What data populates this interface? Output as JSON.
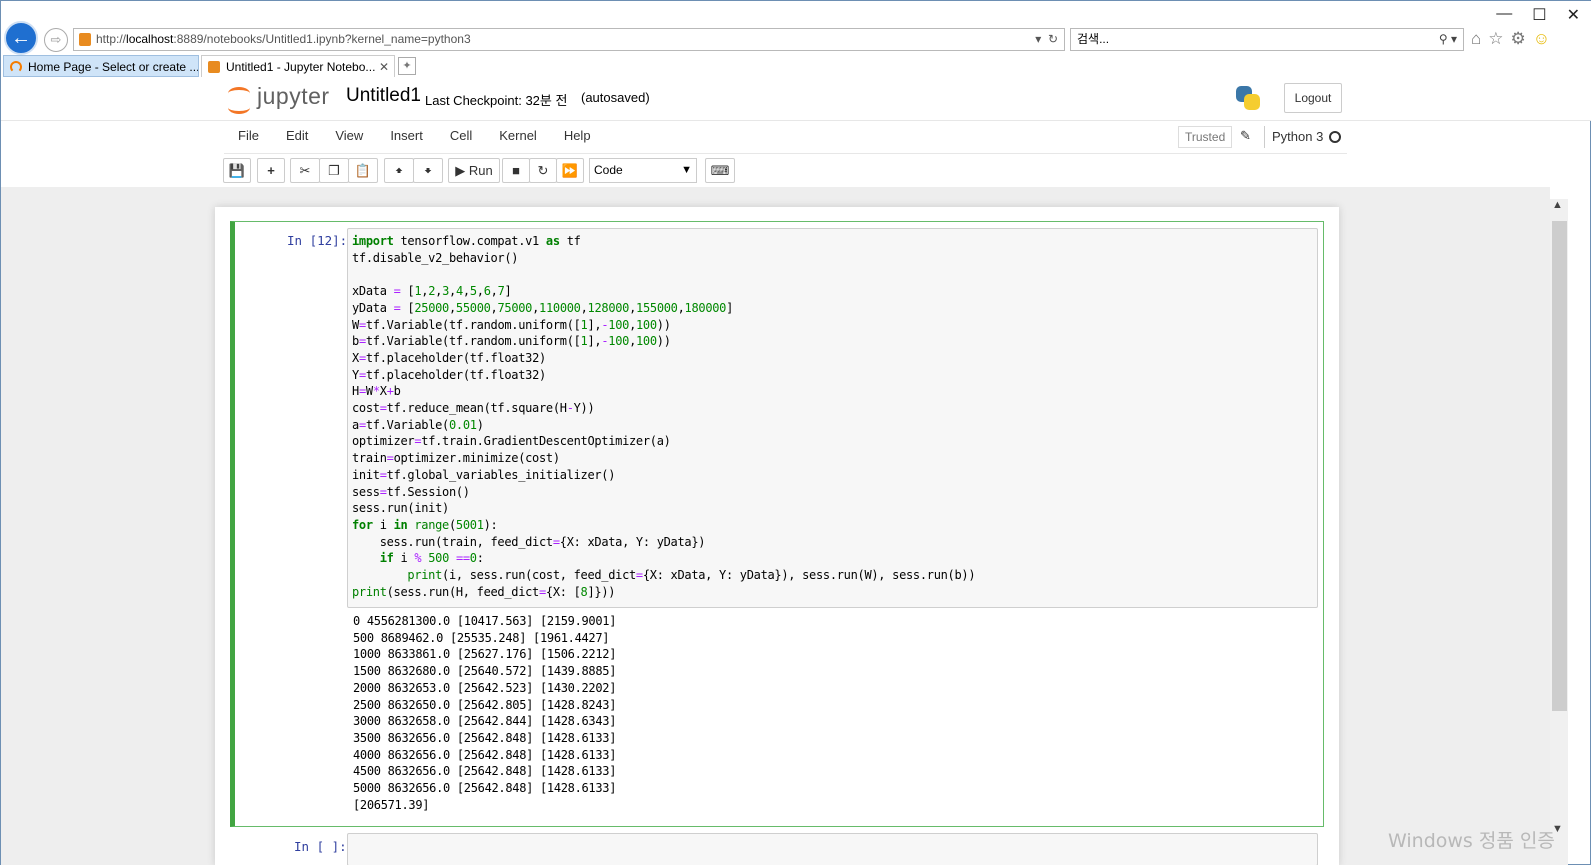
{
  "browser": {
    "url_prefix": "http://",
    "url_host": "localhost",
    "url_rest": ":8889/notebooks/Untitled1.ipynb?kernel_name=python3",
    "search_placeholder": "검색...",
    "tabs": [
      {
        "label": "Home Page - Select or create ..."
      },
      {
        "label": "Untitled1 - Jupyter Notebo..."
      }
    ]
  },
  "header": {
    "wordmark": "jupyter",
    "notebook_title": "Untitled1",
    "checkpoint": "Last Checkpoint: 32분 전",
    "autosave_status": "(autosaved)",
    "logout_label": "Logout"
  },
  "menubar": {
    "items": [
      "File",
      "Edit",
      "View",
      "Insert",
      "Cell",
      "Kernel",
      "Help"
    ],
    "trusted_label": "Trusted",
    "kernel_name": "Python 3"
  },
  "toolbar": {
    "run_label": "Run",
    "cell_type": "Code"
  },
  "cells": [
    {
      "prompt": "In [12]:",
      "output": "0 4556281300.0 [10417.563] [2159.9001]\n500 8689462.0 [25535.248] [1961.4427]\n1000 8633861.0 [25627.176] [1506.2212]\n1500 8632680.0 [25640.572] [1439.8885]\n2000 8632653.0 [25642.523] [1430.2202]\n2500 8632650.0 [25642.805] [1428.8243]\n3000 8632658.0 [25642.844] [1428.6343]\n3500 8632656.0 [25642.848] [1428.6133]\n4000 8632656.0 [25642.848] [1428.6133]\n4500 8632656.0 [25642.848] [1428.6133]\n5000 8632656.0 [25642.848] [1428.6133]\n[206571.39]"
    },
    {
      "prompt": "In [ ]:"
    }
  ],
  "watermark": "Windows 정품 인증",
  "colors": {
    "cell_border": "#66bb6a",
    "prompt": "#303f9f",
    "keyword": "#008000",
    "jupyter_orange": "#f37626"
  }
}
